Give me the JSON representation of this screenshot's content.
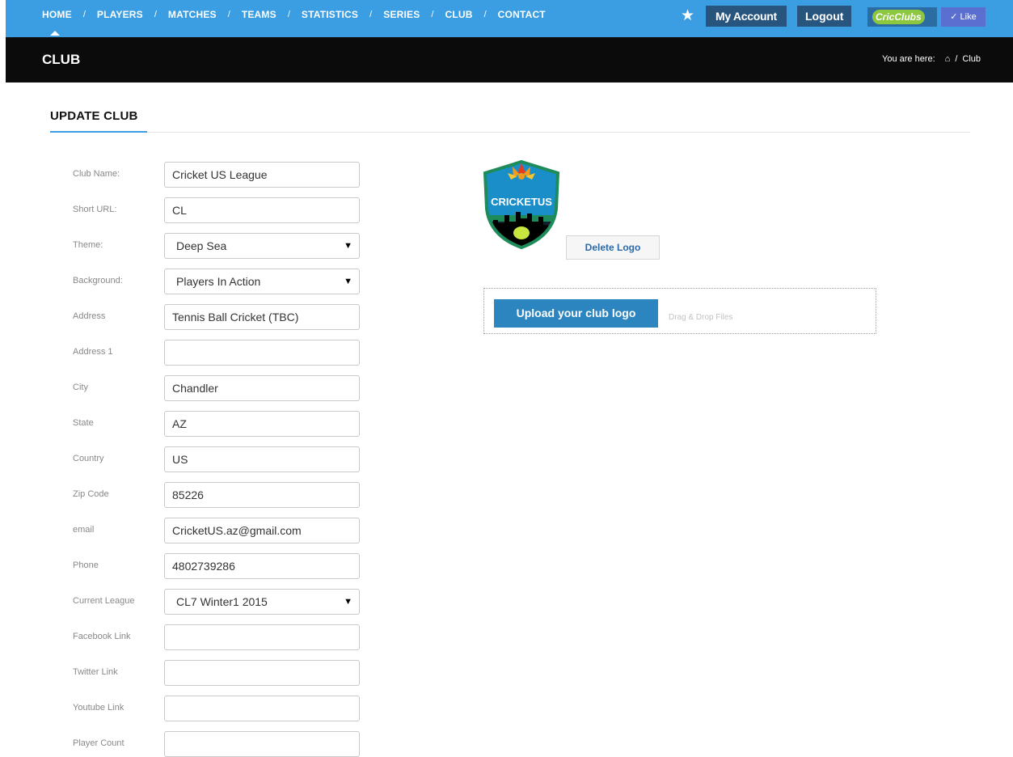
{
  "nav": {
    "items": [
      "HOME",
      "PLAYERS",
      "MATCHES",
      "TEAMS",
      "STATISTICS",
      "SERIES",
      "CLUB",
      "CONTACT"
    ],
    "separator": "/",
    "my_account": "My Account",
    "logout": "Logout",
    "brand": "CricClubs",
    "like": "✓ Like"
  },
  "header": {
    "title": "CLUB",
    "breadcrumb_prefix": "You are here:",
    "breadcrumb_sep": "/",
    "breadcrumb_current": "Club"
  },
  "section": {
    "title": "UPDATE CLUB"
  },
  "form": {
    "club_name": {
      "label": "Club Name:",
      "value": "Cricket US League"
    },
    "short_url": {
      "label": "Short URL:",
      "value": "CL"
    },
    "theme": {
      "label": "Theme:",
      "value": "Deep Sea"
    },
    "background": {
      "label": "Background:",
      "value": "Players In Action"
    },
    "address": {
      "label": "Address",
      "value": "Tennis Ball Cricket (TBC)"
    },
    "address1": {
      "label": "Address 1",
      "value": ""
    },
    "city": {
      "label": "City",
      "value": "Chandler"
    },
    "state": {
      "label": "State",
      "value": "AZ"
    },
    "country": {
      "label": "Country",
      "value": "US"
    },
    "zip": {
      "label": "Zip Code",
      "value": "85226"
    },
    "email": {
      "label": "email",
      "value": "CricketUS.az@gmail.com"
    },
    "phone": {
      "label": "Phone",
      "value": "4802739286"
    },
    "current_league": {
      "label": "Current League",
      "value": "CL7 Winter1 2015"
    },
    "facebook": {
      "label": "Facebook Link",
      "value": ""
    },
    "twitter": {
      "label": "Twitter Link",
      "value": ""
    },
    "youtube": {
      "label": "Youtube Link",
      "value": ""
    },
    "player_count": {
      "label": "Player Count",
      "value": ""
    }
  },
  "logo_panel": {
    "logo_text": "CRICKETUS",
    "delete_label": "Delete Logo",
    "upload_label": "Upload your club logo",
    "drag_text": "Drag & Drop Files"
  },
  "colors": {
    "nav_bg": "#3b9de2",
    "header_bg": "#0b0b0b",
    "button_dark": "#27557e",
    "upload_button": "#2c85bf"
  }
}
